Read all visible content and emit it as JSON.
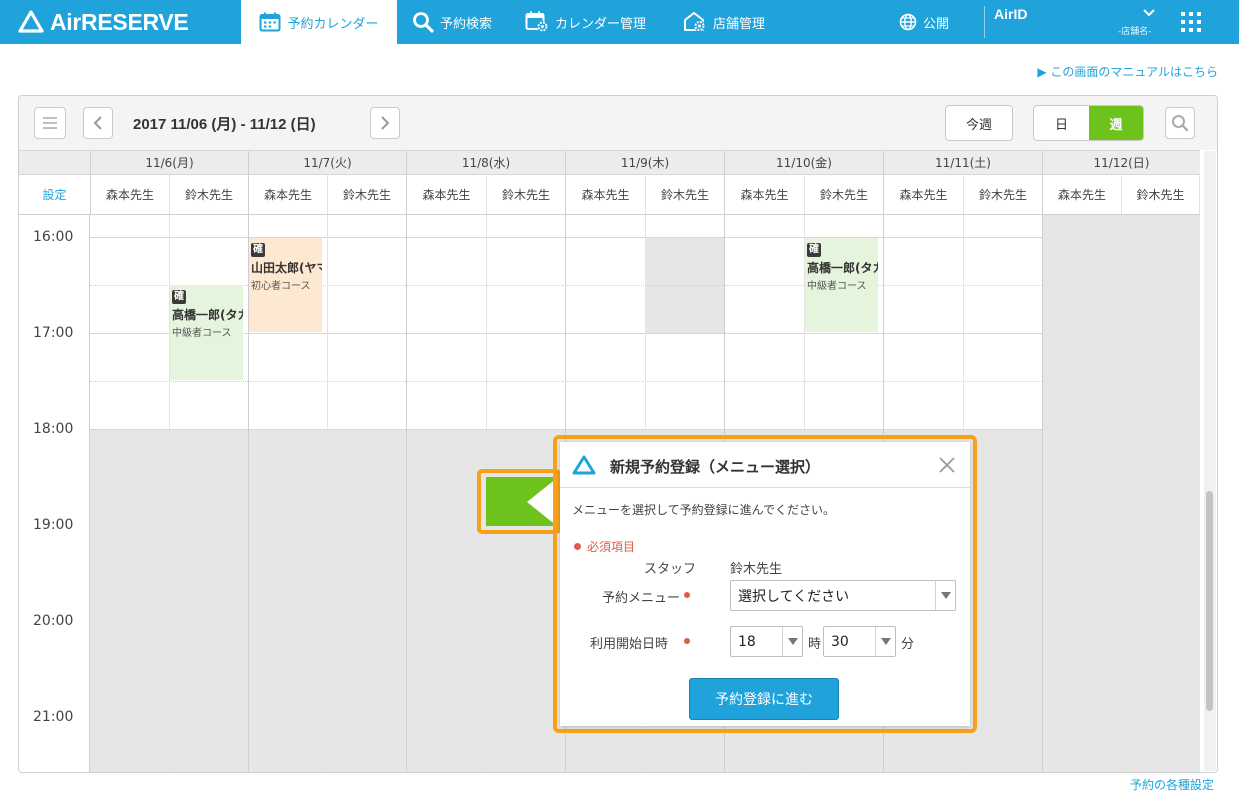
{
  "nav": {
    "logo": "AirRESERVE",
    "items": [
      {
        "label": "予約カレンダー",
        "icon": "calendar-icon",
        "active": true
      },
      {
        "label": "予約検索",
        "icon": "search-icon",
        "active": false
      },
      {
        "label": "カレンダー管理",
        "icon": "calendar-gear-icon",
        "active": false
      },
      {
        "label": "店舗管理",
        "icon": "store-gear-icon",
        "active": false
      }
    ],
    "publish": "公開",
    "airid": "AirID",
    "shop": "-店舗名-"
  },
  "manual_link": "▶ この画面のマニュアルはこちら",
  "toolbar": {
    "range": "2017 11/06 (月) - 11/12 (日)",
    "this_week": "今週",
    "view_day": "日",
    "view_week": "週"
  },
  "calendar": {
    "settings": "設定",
    "days": [
      "11/6(月)",
      "11/7(火)",
      "11/8(水)",
      "11/9(木)",
      "11/10(金)",
      "11/11(土)",
      "11/12(日)"
    ],
    "staff": [
      "森本先生",
      "鈴木先生"
    ],
    "times": [
      "16:00",
      "17:00",
      "18:00",
      "19:00",
      "20:00",
      "21:00"
    ],
    "events": [
      {
        "badge": "確",
        "name": "高橋一郎(タカハシイチロウ)",
        "course": "中級者コース",
        "color": "green"
      },
      {
        "badge": "確",
        "name": "山田太郎(ヤマダタロウ)",
        "course": "初心者コース",
        "color": "orange"
      },
      {
        "badge": "確",
        "name": "高橋一郎(タカハシイチロウ)",
        "course": "中級者コース",
        "color": "green"
      }
    ]
  },
  "modal": {
    "title": "新規予約登録（メニュー選択）",
    "description": "メニューを選択して予約登録に進んでください。",
    "required_note": "必須項目",
    "staff_label": "スタッフ",
    "staff_value": "鈴木先生",
    "menu_label": "予約メニュー",
    "menu_value": "選択してください",
    "start_label": "利用開始日時",
    "hour_value": "18",
    "hour_unit": "時",
    "minute_value": "30",
    "minute_unit": "分",
    "submit": "予約登録に進む"
  },
  "footer_link": "予約の各種設定",
  "colors": {
    "brand": "#1fa3da",
    "accent_green": "#6ec21c",
    "highlight": "#f7a11a",
    "required": "#e05a4a"
  }
}
